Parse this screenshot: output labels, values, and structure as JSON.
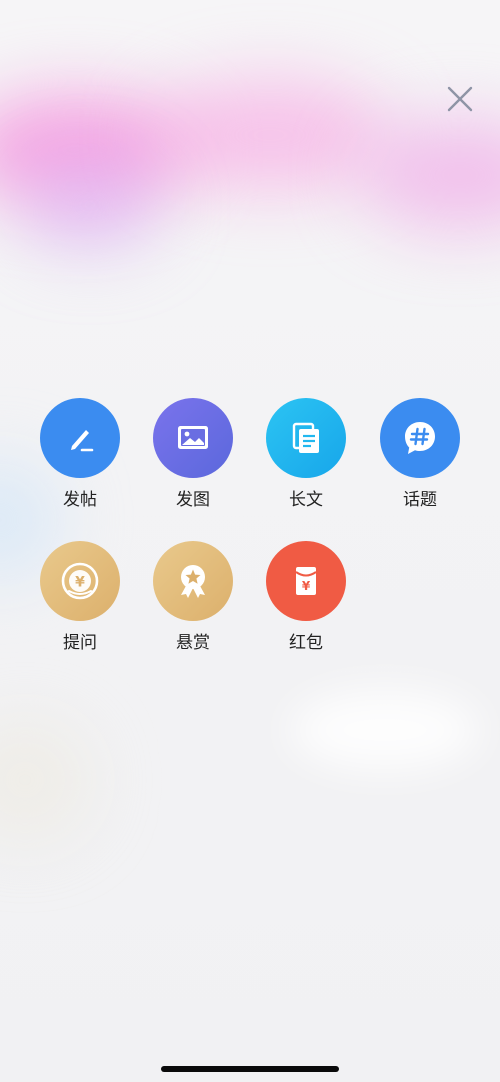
{
  "close": {
    "icon": "close-icon"
  },
  "actions": [
    {
      "key": "post",
      "label": "发帖",
      "icon": "pen-icon",
      "color": "#3b8cf0"
    },
    {
      "key": "image",
      "label": "发图",
      "icon": "image-icon",
      "color": "#6b6de4"
    },
    {
      "key": "long",
      "label": "长文",
      "icon": "document-icon",
      "color": "#21b6ef"
    },
    {
      "key": "topic",
      "label": "话题",
      "icon": "hashtag-icon",
      "color": "#3b8cf0"
    },
    {
      "key": "question",
      "label": "提问",
      "icon": "coin-yen-icon",
      "color": "#e2bb7b"
    },
    {
      "key": "bounty",
      "label": "悬赏",
      "icon": "award-medal-icon",
      "color": "#e2bb7b"
    },
    {
      "key": "redpack",
      "label": "红包",
      "icon": "red-envelope-icon",
      "color": "#f05b44"
    }
  ],
  "glyphs": {
    "yen": "¥"
  }
}
